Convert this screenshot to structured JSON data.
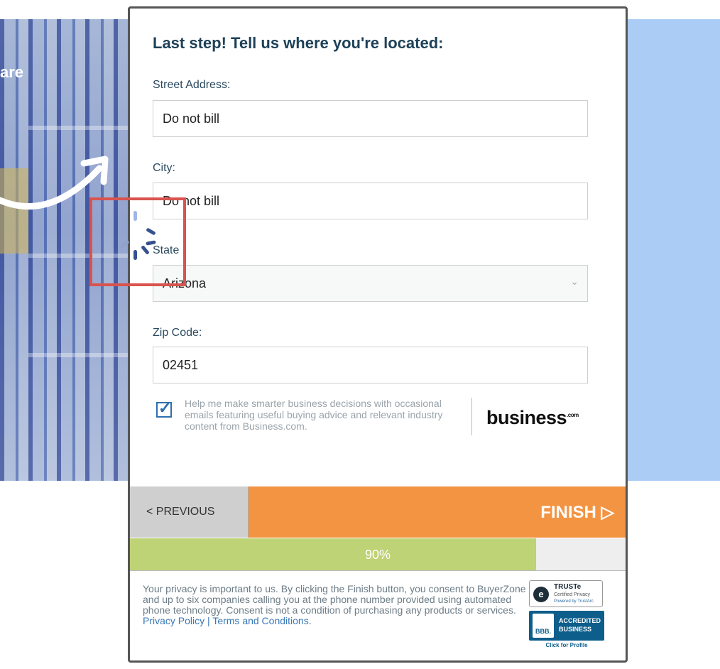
{
  "background": {
    "partial_headline": "are"
  },
  "form": {
    "title": "Last step! Tell us where you're located:",
    "street": {
      "label": "Street Address:",
      "value": "Do not bill"
    },
    "city": {
      "label": "City:",
      "value": "Do not bill"
    },
    "state": {
      "label": "State",
      "value": "Arizona"
    },
    "zip": {
      "label": "Zip Code:",
      "value": "02451"
    },
    "consent": {
      "checked": true,
      "text": "Help me make smarter business decisions with occasional emails featuring useful buying advice and relevant industry content from Business.com.",
      "logo_text": "business",
      "logo_suffix": ".com"
    }
  },
  "nav": {
    "previous_label": "< PREVIOUS",
    "finish_label": "FINISH ▷"
  },
  "progress": {
    "percent": 90,
    "label": "90%"
  },
  "privacy": {
    "text": "Your privacy is important to us. By clicking the Finish button, you consent to BuyerZone and up to six companies calling you at the phone number provided using automated phone technology. Consent is not a condition of purchasing any products or services.",
    "privacy_link": "Privacy Policy",
    "separator": " | ",
    "terms_link": "Terms and Conditions."
  },
  "badges": {
    "truste_title": "TRUSTe",
    "truste_sub": "Certified Privacy",
    "truste_powered": "Powered by TrustArc",
    "bbb_seal": "BBB.",
    "bbb_line1": "ACCREDITED",
    "bbb_line2": "BUSINESS",
    "bbb_cta": "Click for Profile"
  },
  "colors": {
    "finish": "#f39443",
    "progress": "#bed276",
    "title": "#1e4158",
    "right_panel": "#abcdf5",
    "highlight": "#d9534f"
  },
  "icons": [
    "arrow-icon",
    "chevron-down-icon",
    "checkbox-icon",
    "loading-spinner-icon"
  ]
}
